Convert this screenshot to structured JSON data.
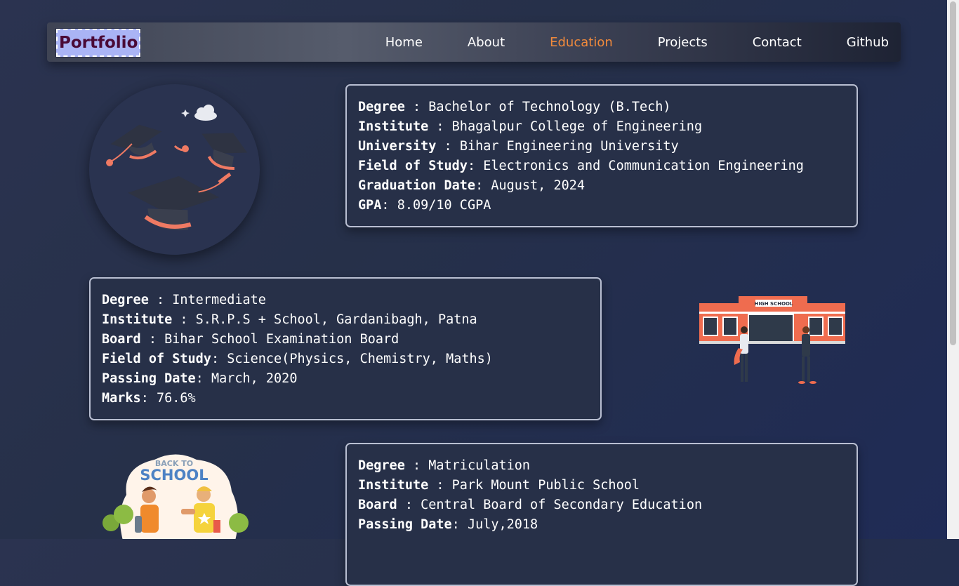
{
  "nav": {
    "logo": "Portfolio",
    "links": [
      "Home",
      "About",
      "Education",
      "Projects",
      "Contact",
      "Github"
    ],
    "active": "Education"
  },
  "education": [
    {
      "rows": [
        {
          "label": "Degree",
          "sep": " : ",
          "value": "Bachelor of Technology (B.Tech)"
        },
        {
          "label": "Institute",
          "sep": " : ",
          "value": "Bhagalpur College of Engineering"
        },
        {
          "label": "University",
          "sep": " : ",
          "value": "Bihar Engineering University"
        },
        {
          "label": "Field of Study",
          "sep": ": ",
          "value": "Electronics and Communication Engineering"
        },
        {
          "label": "Graduation Date",
          "sep": ": ",
          "value": "August, 2024"
        },
        {
          "label": "GPA",
          "sep": ": ",
          "value": "8.09/10 CGPA"
        }
      ]
    },
    {
      "rows": [
        {
          "label": "Degree",
          "sep": " : ",
          "value": "Intermediate"
        },
        {
          "label": "Institute",
          "sep": " : ",
          "value": "S.R.P.S + School, Gardanibagh, Patna"
        },
        {
          "label": "Board",
          "sep": " : ",
          "value": "Bihar School Examination Board"
        },
        {
          "label": "Field of Study",
          "sep": ": ",
          "value": "Science(Physics, Chemistry, Maths)"
        },
        {
          "label": "Passing Date",
          "sep": ": ",
          "value": "March, 2020"
        },
        {
          "label": "Marks",
          "sep": ": ",
          "value": "76.6%"
        }
      ]
    },
    {
      "rows": [
        {
          "label": "Degree",
          "sep": " : ",
          "value": "Matriculation"
        },
        {
          "label": "Institute",
          "sep": " : ",
          "value": "Park Mount Public School"
        },
        {
          "label": "Board",
          "sep": " : ",
          "value": "Central Board of Secondary Education"
        },
        {
          "label": "Passing Date",
          "sep": ": ",
          "value": "July,2018"
        }
      ]
    }
  ],
  "illustrations": {
    "school_sign": "HIGH SCHOOL",
    "back_to": "BACK TO",
    "school": "SCHOOL"
  },
  "colors": {
    "accent": "#f08a3c",
    "logo_bg": "#aab4f5",
    "logo_text": "#4a0a36"
  }
}
